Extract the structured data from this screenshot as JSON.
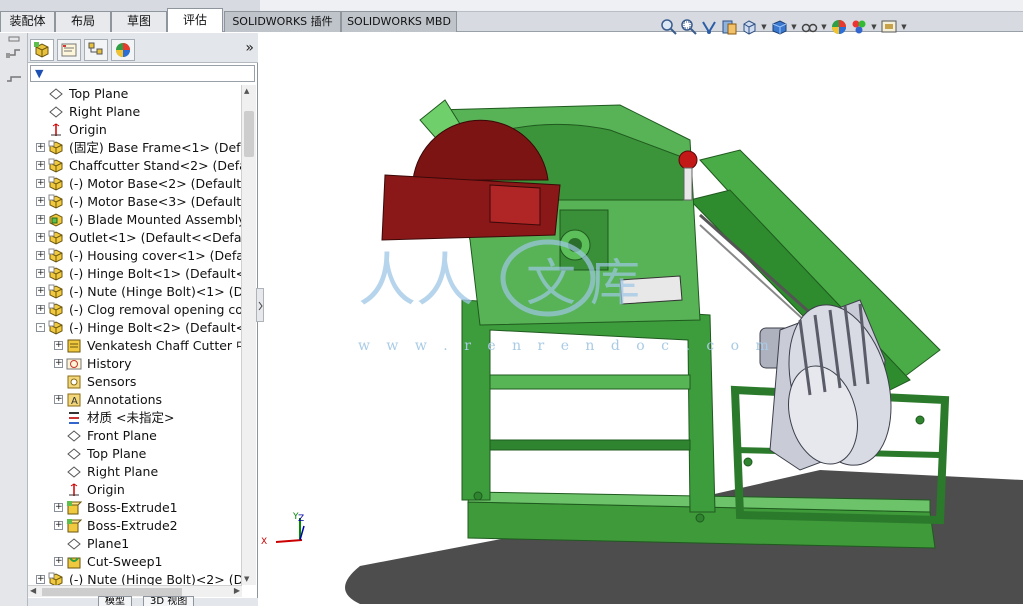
{
  "command_tabs": [
    {
      "label": "装配体",
      "state": "normal"
    },
    {
      "label": "布局",
      "state": "normal"
    },
    {
      "label": "草图",
      "state": "normal"
    },
    {
      "label": "评估",
      "state": "active"
    },
    {
      "label": "SOLIDWORKS 插件",
      "state": "dark"
    },
    {
      "label": "SOLIDWORKS MBD",
      "state": "dark"
    }
  ],
  "view_toolbar": {
    "icons": [
      "zoom-to-fit-icon",
      "zoom-to-area-icon",
      "previous-view-icon",
      "section-view-icon",
      "view-orientation-icon",
      "display-style-icon",
      "hide-show-items-icon",
      "edit-appearance-icon",
      "apply-scene-icon",
      "view-settings-icon"
    ]
  },
  "feature_manager": {
    "panel_tabs": [
      "featuremanager-tree-icon",
      "propertymanager-icon",
      "configurationmanager-icon",
      "displaymanager-icon"
    ],
    "expand_glyph": "»",
    "filter_glyph": "▼",
    "tree": [
      {
        "label": "Top Plane",
        "icon": "plane-icon",
        "indent": 0,
        "expander": ""
      },
      {
        "label": "Right Plane",
        "icon": "plane-icon",
        "indent": 0,
        "expander": ""
      },
      {
        "label": "Origin",
        "icon": "origin-icon",
        "indent": 0,
        "expander": ""
      },
      {
        "label": "(固定) Base Frame<1> (Defau",
        "icon": "part-icon",
        "indent": 0,
        "expander": "+"
      },
      {
        "label": "Chaffcutter Stand<2> (Defaul",
        "icon": "part-icon",
        "indent": 0,
        "expander": "+"
      },
      {
        "label": "(-) Motor Base<2> (Default<",
        "icon": "part-icon",
        "indent": 0,
        "expander": "+"
      },
      {
        "label": "(-) Motor Base<3> (Default<",
        "icon": "part-icon",
        "indent": 0,
        "expander": "+"
      },
      {
        "label": "(-) Blade Mounted Assembly<",
        "icon": "assembly-icon",
        "indent": 0,
        "expander": "+"
      },
      {
        "label": "Outlet<1> (Default<<Default:",
        "icon": "part-icon",
        "indent": 0,
        "expander": "+"
      },
      {
        "label": "(-) Housing cover<1> (Defaul",
        "icon": "part-icon",
        "indent": 0,
        "expander": "+"
      },
      {
        "label": "(-) Hinge Bolt<1> (Default<<",
        "icon": "part-icon",
        "indent": 0,
        "expander": "+"
      },
      {
        "label": "(-) Nute (Hinge Bolt)<1> (Def",
        "icon": "part-icon",
        "indent": 0,
        "expander": "+"
      },
      {
        "label": "(-) Clog removal opening cov",
        "icon": "part-icon",
        "indent": 0,
        "expander": "+"
      },
      {
        "label": "(-) Hinge Bolt<2> (Default<<",
        "icon": "part-icon",
        "indent": 0,
        "expander": "-"
      },
      {
        "label": "Venkatesh Chaff Cutter 中的",
        "icon": "sensor-doc-icon",
        "indent": 1,
        "expander": "+"
      },
      {
        "label": "History",
        "icon": "history-icon",
        "indent": 1,
        "expander": "+"
      },
      {
        "label": "Sensors",
        "icon": "sensors-icon",
        "indent": 1,
        "expander": ""
      },
      {
        "label": "Annotations",
        "icon": "annotations-icon",
        "indent": 1,
        "expander": "+"
      },
      {
        "label": "材质 <未指定>",
        "icon": "material-icon",
        "indent": 1,
        "expander": ""
      },
      {
        "label": "Front Plane",
        "icon": "plane-icon",
        "indent": 1,
        "expander": ""
      },
      {
        "label": "Top Plane",
        "icon": "plane-icon",
        "indent": 1,
        "expander": ""
      },
      {
        "label": "Right Plane",
        "icon": "plane-icon",
        "indent": 1,
        "expander": ""
      },
      {
        "label": "Origin",
        "icon": "origin-icon",
        "indent": 1,
        "expander": ""
      },
      {
        "label": "Boss-Extrude1",
        "icon": "boss-extrude-icon",
        "indent": 1,
        "expander": "+"
      },
      {
        "label": "Boss-Extrude2",
        "icon": "boss-extrude-icon",
        "indent": 1,
        "expander": "+"
      },
      {
        "label": "Plane1",
        "icon": "plane-icon",
        "indent": 1,
        "expander": ""
      },
      {
        "label": "Cut-Sweep1",
        "icon": "cut-sweep-icon",
        "indent": 1,
        "expander": "+"
      },
      {
        "label": "(-) Nute (Hinge Bolt)<2> (Def",
        "icon": "part-icon",
        "indent": 0,
        "expander": "+"
      }
    ]
  },
  "bottom_tabs": [
    "模型",
    "3D 视图"
  ],
  "graphics": {
    "watermark_text": "w w w . r e n r e n d o c . c o m",
    "triad": {
      "x": "X",
      "y": "Y",
      "z": "Z"
    },
    "colors": {
      "frame_green": "#3a9a3a",
      "frame_green_light": "#5cc05a",
      "blade_red": "#7d1414",
      "motor_grey": "#c9ccd6"
    }
  }
}
